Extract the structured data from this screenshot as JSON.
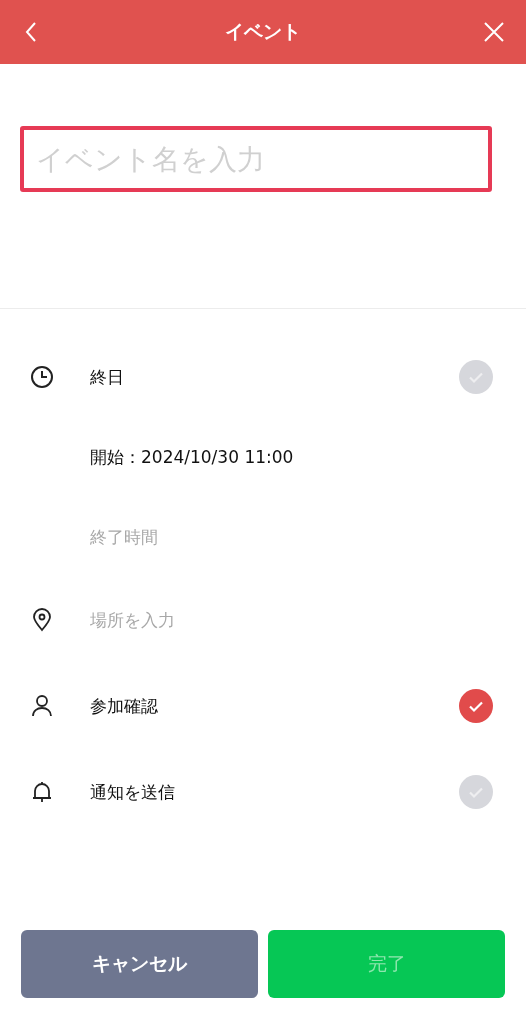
{
  "header": {
    "title": "イベント"
  },
  "event_name": {
    "placeholder": "イベント名を入力"
  },
  "rows": [
    {
      "kind": "toggle",
      "label": "終日",
      "checked": false
    },
    {
      "kind": "text",
      "label": "開始：2024/10/30 11:00"
    },
    {
      "kind": "hint",
      "label": "終了時間"
    },
    {
      "kind": "hint",
      "label": "場所を入力"
    },
    {
      "kind": "toggle",
      "label": "参加確認",
      "checked": true
    },
    {
      "kind": "toggle",
      "label": "通知を送信",
      "checked": false
    }
  ],
  "buttons": [
    {
      "kind": "cancel",
      "label": "キャンセル",
      "disabled": false
    },
    {
      "kind": "done",
      "label": "完了",
      "disabled": true
    }
  ]
}
